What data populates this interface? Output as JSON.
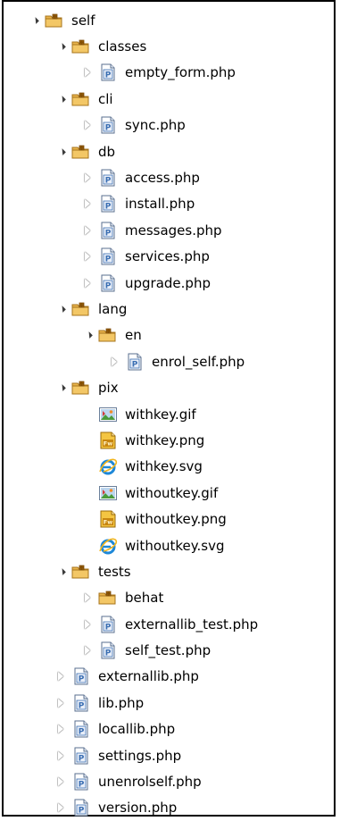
{
  "tree": [
    {
      "label": "self",
      "type": "package",
      "toggle": "expanded",
      "depth": 0
    },
    {
      "label": "classes",
      "type": "package",
      "toggle": "expanded",
      "depth": 1
    },
    {
      "label": "empty_form.php",
      "type": "php",
      "toggle": "collapsed",
      "depth": 2
    },
    {
      "label": "cli",
      "type": "package",
      "toggle": "expanded",
      "depth": 1
    },
    {
      "label": "sync.php",
      "type": "php",
      "toggle": "collapsed",
      "depth": 2
    },
    {
      "label": "db",
      "type": "package",
      "toggle": "expanded",
      "depth": 1
    },
    {
      "label": "access.php",
      "type": "php",
      "toggle": "collapsed",
      "depth": 2
    },
    {
      "label": "install.php",
      "type": "php",
      "toggle": "collapsed",
      "depth": 2
    },
    {
      "label": "messages.php",
      "type": "php",
      "toggle": "collapsed",
      "depth": 2
    },
    {
      "label": "services.php",
      "type": "php",
      "toggle": "collapsed",
      "depth": 2
    },
    {
      "label": "upgrade.php",
      "type": "php",
      "toggle": "collapsed",
      "depth": 2
    },
    {
      "label": "lang",
      "type": "package",
      "toggle": "expanded",
      "depth": 1
    },
    {
      "label": "en",
      "type": "package",
      "toggle": "expanded",
      "depth": 2
    },
    {
      "label": "enrol_self.php",
      "type": "php",
      "toggle": "collapsed",
      "depth": 3
    },
    {
      "label": "pix",
      "type": "package",
      "toggle": "expanded",
      "depth": 1
    },
    {
      "label": "withkey.gif",
      "type": "gif",
      "toggle": "none",
      "depth": 2
    },
    {
      "label": "withkey.png",
      "type": "png",
      "toggle": "none",
      "depth": 2
    },
    {
      "label": "withkey.svg",
      "type": "svg",
      "toggle": "none",
      "depth": 2
    },
    {
      "label": "withoutkey.gif",
      "type": "gif",
      "toggle": "none",
      "depth": 2
    },
    {
      "label": "withoutkey.png",
      "type": "png",
      "toggle": "none",
      "depth": 2
    },
    {
      "label": "withoutkey.svg",
      "type": "svg",
      "toggle": "none",
      "depth": 2
    },
    {
      "label": "tests",
      "type": "package",
      "toggle": "expanded",
      "depth": 1
    },
    {
      "label": "behat",
      "type": "package",
      "toggle": "collapsed",
      "depth": 2
    },
    {
      "label": "externallib_test.php",
      "type": "php",
      "toggle": "collapsed",
      "depth": 2
    },
    {
      "label": "self_test.php",
      "type": "php",
      "toggle": "collapsed",
      "depth": 2
    },
    {
      "label": "externallib.php",
      "type": "php",
      "toggle": "collapsed",
      "depth": 1
    },
    {
      "label": "lib.php",
      "type": "php",
      "toggle": "collapsed",
      "depth": 1
    },
    {
      "label": "locallib.php",
      "type": "php",
      "toggle": "collapsed",
      "depth": 1
    },
    {
      "label": "settings.php",
      "type": "php",
      "toggle": "collapsed",
      "depth": 1
    },
    {
      "label": "unenrolself.php",
      "type": "php",
      "toggle": "collapsed",
      "depth": 1
    },
    {
      "label": "version.php",
      "type": "php",
      "toggle": "collapsed",
      "depth": 1
    }
  ],
  "icons": {
    "package": "package-folder-icon",
    "php": "php-file-icon",
    "gif": "gif-image-icon",
    "png": "png-fireworks-icon",
    "svg": "svg-ie-icon"
  },
  "colors": {
    "folder": "#d9a441",
    "php_blue": "#3b6fb3",
    "ie_blue": "#1e88d8",
    "fireworks": "#f0b429"
  }
}
